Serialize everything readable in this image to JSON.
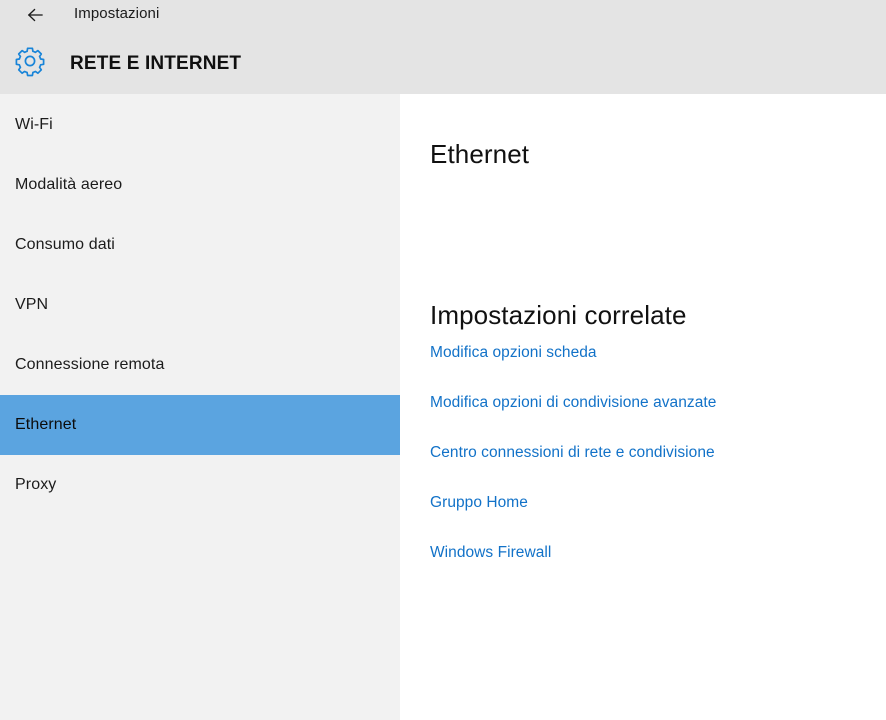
{
  "window": {
    "title": "Impostazioni",
    "back_icon": "back-arrow-icon"
  },
  "category": {
    "icon": "gear-icon",
    "title": "RETE E INTERNET"
  },
  "sidebar": {
    "items": [
      {
        "label": "Wi-Fi",
        "selected": false
      },
      {
        "label": "Modalità aereo",
        "selected": false
      },
      {
        "label": "Consumo dati",
        "selected": false
      },
      {
        "label": "VPN",
        "selected": false
      },
      {
        "label": "Connessione remota",
        "selected": false
      },
      {
        "label": "Ethernet",
        "selected": true
      },
      {
        "label": "Proxy",
        "selected": false
      }
    ]
  },
  "main": {
    "heading": "Ethernet",
    "related_heading": "Impostazioni correlate",
    "related_links": [
      {
        "label": "Modifica opzioni scheda"
      },
      {
        "label": "Modifica opzioni di condivisione avanzate"
      },
      {
        "label": "Centro connessioni di rete e condivisione"
      },
      {
        "label": "Gruppo Home"
      },
      {
        "label": "Windows Firewall"
      }
    ]
  },
  "colors": {
    "header_background": "#e4e4e4",
    "sidebar_background": "#f2f2f2",
    "content_background": "#ffffff",
    "selection_highlight": "#5ba4e0",
    "link_blue": "#1272c8",
    "accent_blue": "#1884d8"
  }
}
